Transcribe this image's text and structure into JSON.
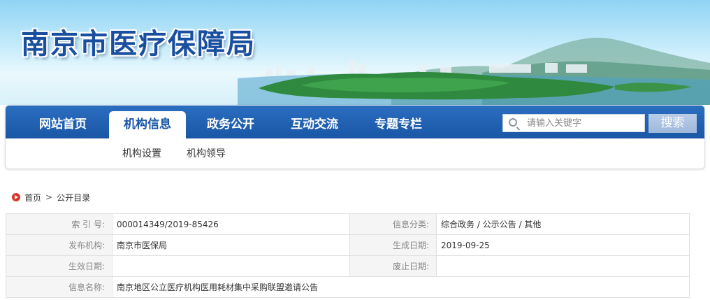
{
  "header": {
    "site_title": "南京市医疗保障局"
  },
  "nav": {
    "items": [
      {
        "label": "网站首页",
        "active": false
      },
      {
        "label": "机构信息",
        "active": true
      },
      {
        "label": "政务公开",
        "active": false
      },
      {
        "label": "互动交流",
        "active": false
      },
      {
        "label": "专题专栏",
        "active": false
      }
    ],
    "sub_items": [
      "机构设置",
      "机构领导"
    ],
    "search": {
      "placeholder": "请输入关键字",
      "button_label": "搜索"
    }
  },
  "breadcrumb": {
    "home": "首页",
    "separator": ">",
    "current": "公开目录"
  },
  "info": {
    "index_no_label": "索 引 号:",
    "index_no": "000014349/2019-85426",
    "category_label": "信息分类:",
    "category": "综合政务 / 公示公告 / 其他",
    "publisher_label": "发布机构:",
    "publisher": "南京市医保局",
    "created_label": "生成日期:",
    "created": "2019-09-25",
    "effective_label": "生效日期:",
    "effective": "",
    "expiry_label": "废止日期:",
    "expiry": "",
    "name_label": "信息名称:",
    "name": "南京地区公立医疗机构医用耗材集中采购联盟邀请公告"
  },
  "colors": {
    "nav_blue": "#1a56a6",
    "title_blue": "#1a4fa0",
    "home_icon_red": "#d9342b"
  }
}
